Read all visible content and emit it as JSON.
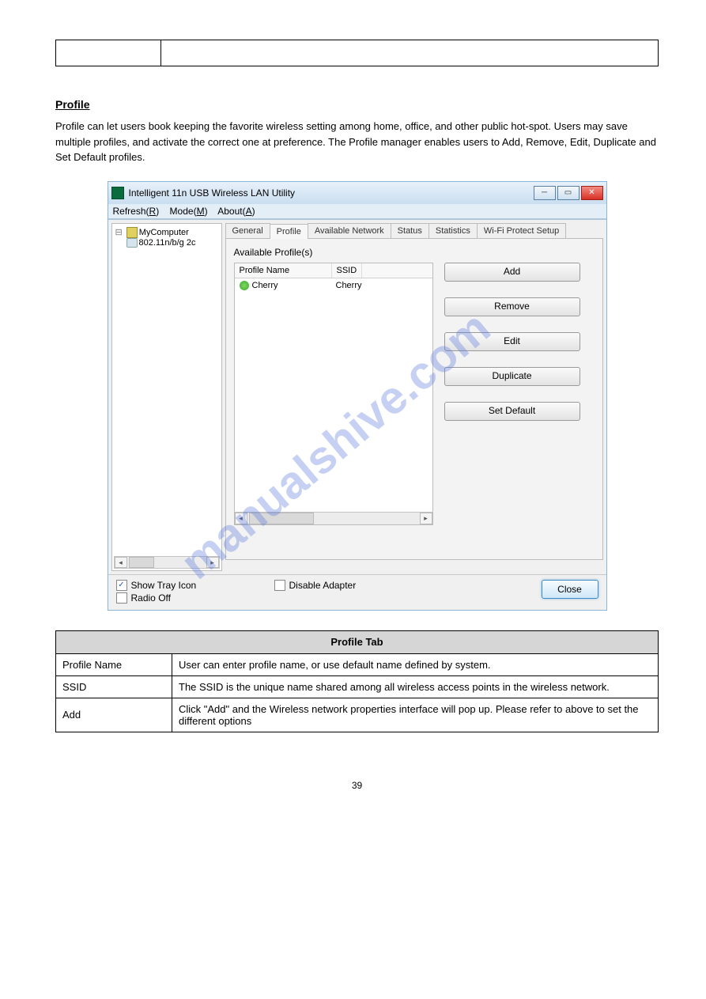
{
  "section": {
    "heading": "Profile",
    "intro": "Profile can let users book keeping the favorite wireless setting among home, office, and other public hot-spot. Users may save multiple profiles, and activate the correct one at preference. The Profile manager enables users to Add, Remove, Edit, Duplicate and Set Default profiles."
  },
  "window": {
    "title": "Intelligent 11n USB Wireless LAN Utility",
    "menus": [
      {
        "label": "Refresh",
        "accel": "R"
      },
      {
        "label": "Mode",
        "accel": "M"
      },
      {
        "label": "About",
        "accel": "A"
      }
    ],
    "tree": {
      "root": "MyComputer",
      "child": "802.11n/b/g 2c"
    },
    "tabs": [
      "General",
      "Profile",
      "Available Network",
      "Status",
      "Statistics",
      "Wi-Fi Protect Setup"
    ],
    "active_tab": "Profile",
    "profile_section_label": "Available Profile(s)",
    "columns": {
      "name": "Profile Name",
      "ssid": "SSID"
    },
    "rows": [
      {
        "name": "Cherry",
        "ssid": "Cherry"
      }
    ],
    "buttons": {
      "add": "Add",
      "remove": "Remove",
      "edit": "Edit",
      "duplicate": "Duplicate",
      "set_default": "Set Default"
    },
    "footer": {
      "show_tray": "Show Tray Icon",
      "radio_off": "Radio Off",
      "disable_adapter": "Disable Adapter",
      "close": "Close"
    }
  },
  "desc_table": {
    "header": "Profile Tab",
    "rows": [
      {
        "k": "Profile Name",
        "v": "User can enter profile name, or use default name defined by system."
      },
      {
        "k": "SSID",
        "v": "The SSID is the unique name shared among all wireless access points in the wireless network."
      },
      {
        "k": "Add",
        "v": "Click \"Add\" and the Wireless network properties interface will pop up. Please refer to above to set the different options"
      }
    ]
  },
  "page_number": "39"
}
